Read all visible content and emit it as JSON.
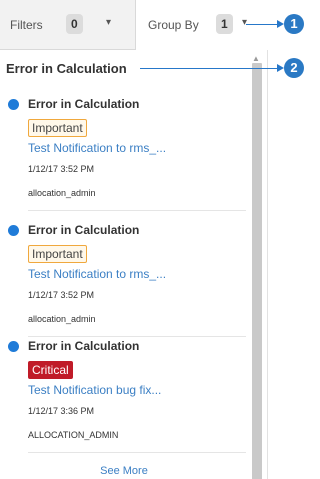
{
  "header": {
    "filters_label": "Filters",
    "filters_count": "0",
    "group_by_label": "Group By",
    "group_by_count": "1"
  },
  "section": {
    "title": "Error in Calculation"
  },
  "items": [
    {
      "title": "Error in Calculation",
      "tag": "Important",
      "tag_color": "#f0a83d",
      "link": "Test Notification to rms_...",
      "time": "1/12/17 3:52 PM",
      "user": "allocation_admin"
    },
    {
      "title": "Error in Calculation",
      "tag": "Important",
      "tag_color": "#f0a83d",
      "link": "Test Notification to rms_...",
      "time": "1/12/17 3:52 PM",
      "user": "allocation_admin"
    },
    {
      "title": "Error in Calculation",
      "tag": "Critical",
      "tag_color": "#c01b28",
      "link": "Test Notification bug fix...",
      "time": "1/12/17 3:36 PM",
      "user": "ALLOCATION_ADMIN"
    }
  ],
  "see_more_label": "See More",
  "callouts": [
    "1",
    "2"
  ],
  "colors": {
    "unread_dot": "#1f7bd8",
    "link": "#3b7fc4",
    "callout": "#2a79c4"
  },
  "icons": {
    "dropdown": "chevron-down-icon",
    "unread": "unread-dot-icon",
    "scroll_up": "scroll-up-arrow-icon"
  }
}
